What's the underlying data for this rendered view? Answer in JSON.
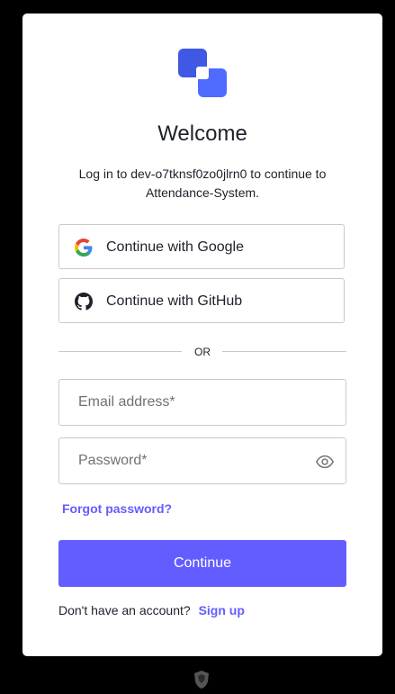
{
  "header": {
    "title": "Welcome",
    "subtitle": "Log in to dev-o7tknsf0zo0jlrn0 to continue to Attendance-System."
  },
  "social": {
    "google_label": "Continue with Google",
    "github_label": "Continue with GitHub"
  },
  "divider": {
    "label": "OR"
  },
  "form": {
    "email_placeholder": "Email address*",
    "password_placeholder": "Password*",
    "forgot_label": "Forgot password?",
    "continue_label": "Continue"
  },
  "signup": {
    "prompt": "Don't have an account?",
    "link_label": "Sign up"
  },
  "colors": {
    "accent": "#635dff",
    "logo_dark": "#3f59e4",
    "logo_light": "#6b7cff",
    "background": "#000000",
    "card": "#ffffff"
  },
  "icons": {
    "logo": "auth-logo-icon",
    "google": "google-icon",
    "github": "github-icon",
    "eye": "eye-icon",
    "footer": "shield-icon"
  }
}
